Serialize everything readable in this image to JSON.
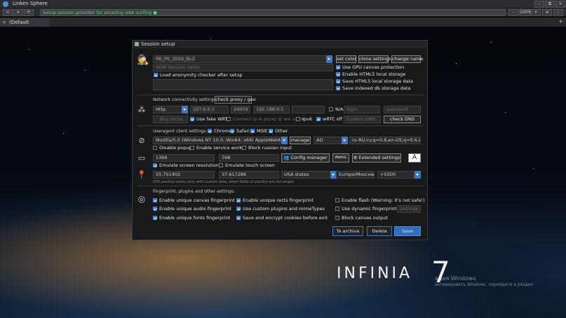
{
  "app": {
    "title": "Linken Sphere",
    "url": "Setup session provider for amazing web surfing",
    "zoom": "100%"
  },
  "tabs": [
    {
      "label": "(Default session)",
      "close": "×"
    }
  ],
  "window_controls": {
    "back": "<",
    "minus": "-",
    "plus": "+",
    "restore": "⧉",
    "close": "×"
  },
  "desktop": {
    "brand": "INFINIA",
    "brand_number": "7",
    "watermark_line1": "ация Windows",
    "watermark_line2": "активировать Windows, перейдите в раздел"
  },
  "dialog": {
    "title": "Session setup",
    "session_name": "RK_PK_2024_BLZ",
    "session_name_placeholder": "NEW Session name",
    "load_checker": "Load anonymity checker after setup",
    "buttons": {
      "set_color": "set color",
      "clone_settings": "clone settings",
      "change_name": "change name"
    },
    "storage": [
      {
        "label": "Use GPU canvas protection",
        "checked": true
      },
      {
        "label": "Enable HTML5 local storage",
        "checked": true
      },
      {
        "label": "Save HTML5 local storage data",
        "checked": true
      },
      {
        "label": "Save indexed db storage data",
        "checked": true
      }
    ],
    "network": {
      "section": "Network connectivity settings:",
      "check_proxy": "check proxy / geo",
      "protocol": "Http",
      "ip": "127.0.0.1",
      "port": "24474",
      "host": "192.168.0.1",
      "na": "N/A",
      "login_placeholder": "login",
      "password_placeholder": "password",
      "buy_socks": "Buy socks",
      "use_fake_webrtc": "Use fake WRTC",
      "connect_ip_same": "Connect ip & proxy ip are same",
      "ipv6": "Ipv6",
      "webrtc_off": "wRTC off",
      "custom_dns": "Custom DNS",
      "check_dns": "check DNS"
    },
    "useragent": {
      "section": "Useragent client settings:",
      "browsers": [
        {
          "label": "Chrome",
          "checked": true
        },
        {
          "label": "Safari",
          "checked": true
        },
        {
          "label": "MSIE",
          "checked": true
        },
        {
          "label": "Other",
          "checked": true
        }
      ],
      "ua_string": "Mozilla/5.0 (Windows NT 10.0; Win64; x64) AppleWebKit/537.36 (KHTML, like Gecko)",
      "manage": "manage",
      "ua_lang": "AD",
      "accept_lang": "ru-RU,ru;q=0.8,en-US;q=0.6,en;q=0.4",
      "disable_popups": "Disable popups",
      "enable_service_worker": "Enable service worker",
      "block_russian_input": "Block russian input"
    },
    "screen": {
      "width": "1366",
      "height": "768",
      "config_manager": "Config manager",
      "webgl": "WebGL",
      "extended_settings": "Extended settings",
      "font_button": "A",
      "emulate_resolution": "Emulate screen resolution",
      "emulate_touch": "Emulate touch screen"
    },
    "geo": {
      "lat": "55.751402",
      "lon": "37.617286",
      "country": "USA states",
      "timezone": "Europe/Moscow",
      "offset": "+0300",
      "note": "GPS position works only with custom data, when fields of country are not empty"
    },
    "fingerprint": {
      "section": "Fingerprint, plugins and other settings:",
      "col1": [
        {
          "label": "Enable unique canvas fingerprint",
          "checked": true
        },
        {
          "label": "Enable unique audio fingerprint",
          "checked": true
        },
        {
          "label": "Enable unique fonts fingerprint",
          "checked": true
        }
      ],
      "col2": [
        {
          "label": "Enable unique rects fingerprint",
          "checked": true
        },
        {
          "label": "Use custom plugins and mimeTypes",
          "checked": true
        },
        {
          "label": "Save and encrypt cookies before exit",
          "checked": true
        }
      ],
      "col3": [
        {
          "label": "Enable flash (Warning: it's not safe!)",
          "checked": false
        },
        {
          "label": "Use dynamic fingerprints",
          "checked": false
        },
        {
          "label": "Block canvas output",
          "checked": false
        }
      ],
      "settings": "settings"
    },
    "actions": {
      "archive": "To archive",
      "delete": "Delete",
      "save": "Save"
    }
  }
}
